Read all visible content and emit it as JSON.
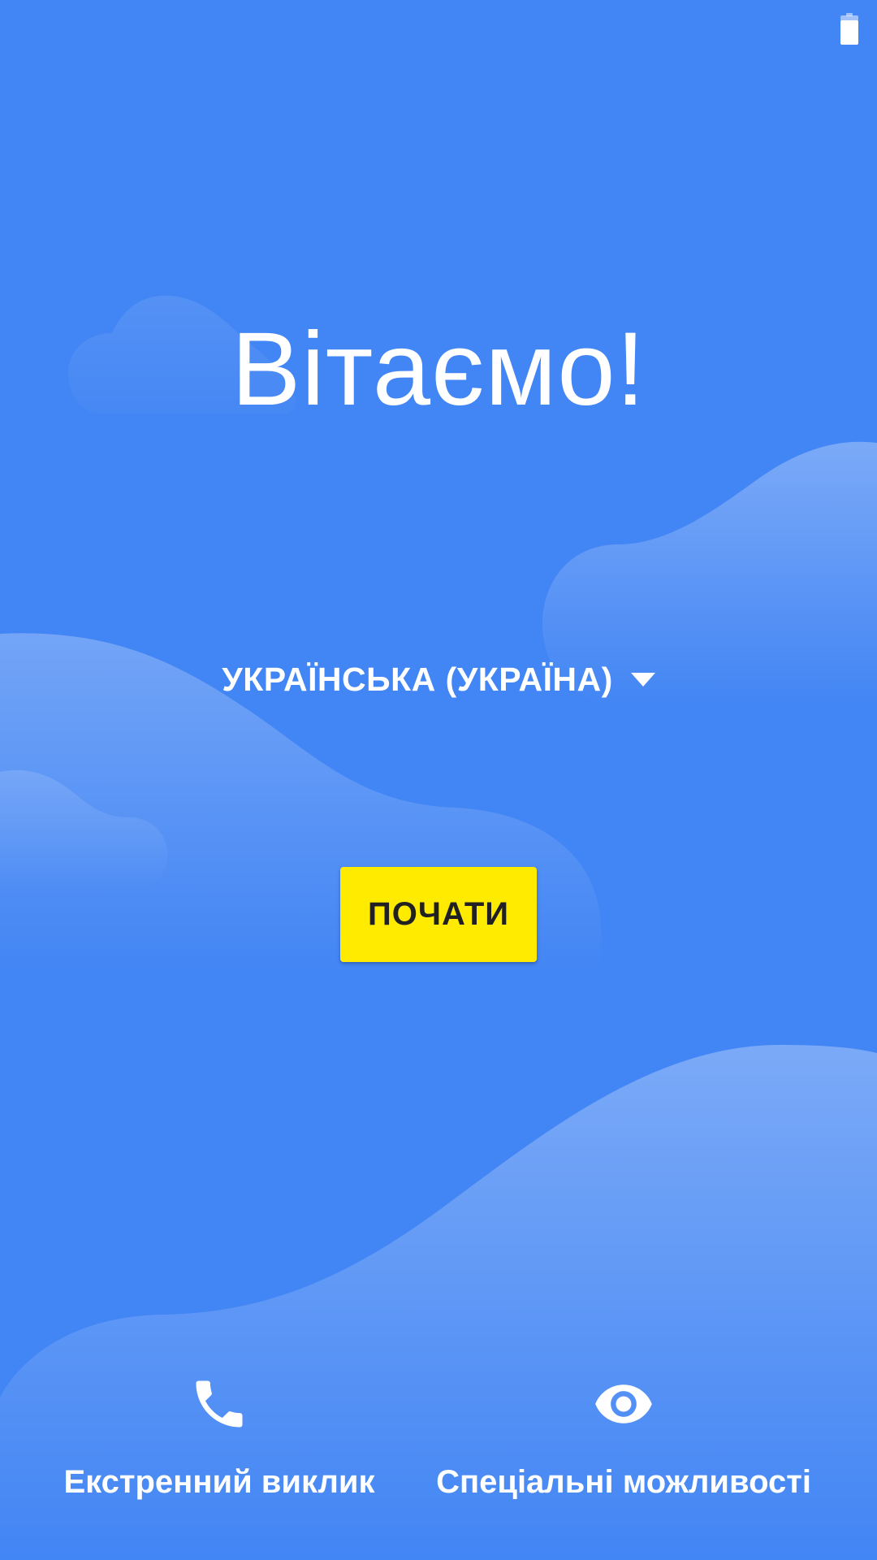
{
  "status_bar": {
    "battery_icon": "battery-full-icon"
  },
  "welcome": {
    "title": "Вітаємо!"
  },
  "language": {
    "selected": "УКРАЇНСЬКА (УКРАЇНА)",
    "dropdown_icon": "dropdown-arrow-icon"
  },
  "start_button": {
    "label": "ПОЧАТИ"
  },
  "bottom_actions": {
    "emergency": {
      "label": "Екстренний виклик",
      "icon": "phone-icon"
    },
    "accessibility": {
      "label": "Спеціальні можливості",
      "icon": "eye-icon"
    }
  },
  "colors": {
    "background": "#4285f4",
    "button": "#ffeb00",
    "button_text": "#212121",
    "text": "#ffffff"
  }
}
